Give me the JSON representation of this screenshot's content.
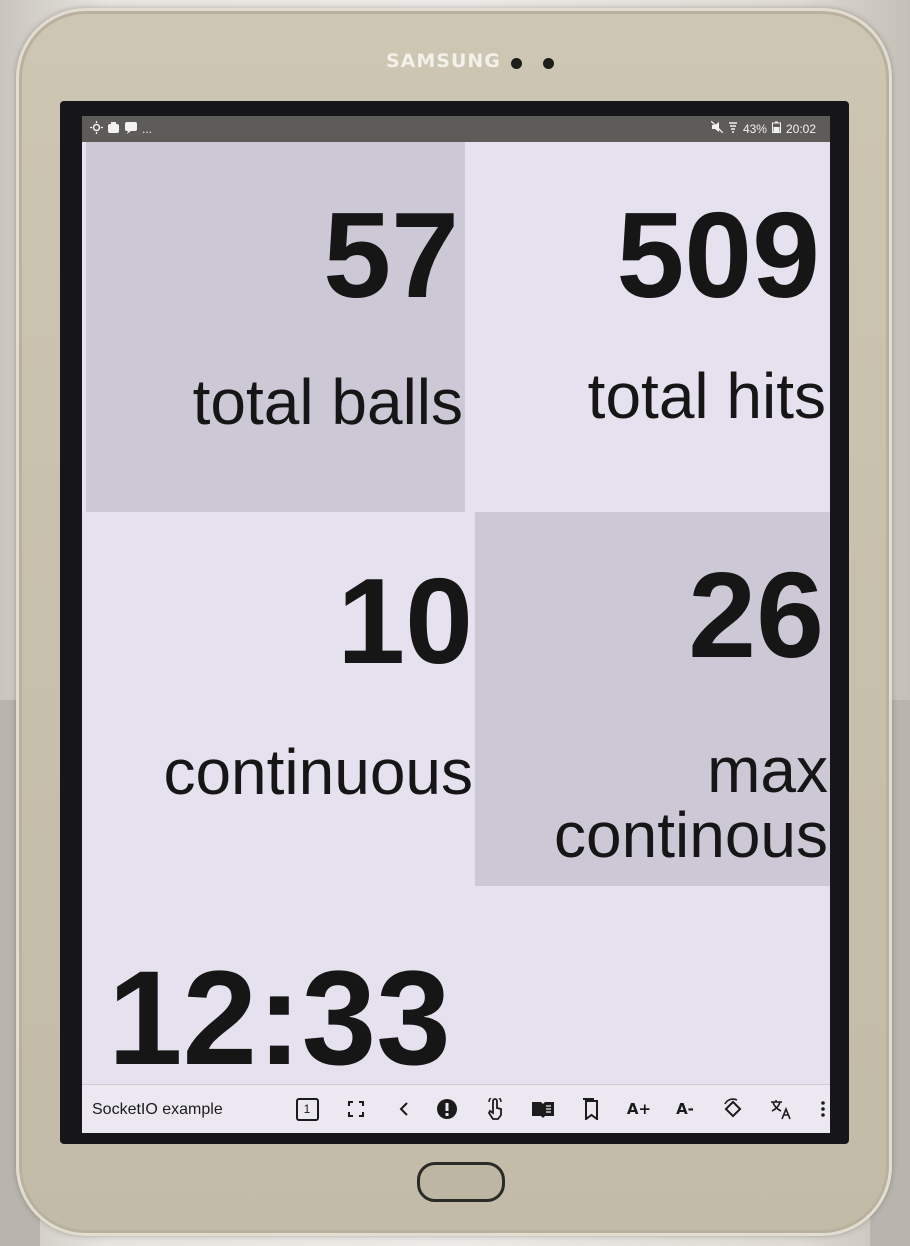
{
  "device": {
    "brand": "SAMSUNG"
  },
  "status_bar": {
    "left_icons": [
      "notification-icon",
      "app-icon",
      "chat-icon"
    ],
    "more": "...",
    "mute_icon": "mute-icon",
    "signal_icon": "signal-icon",
    "battery_percent": "43%",
    "battery_icon": "battery-icon",
    "time": "20:02"
  },
  "stats": {
    "total_balls": {
      "value": "57",
      "label": "total balls"
    },
    "total_hits": {
      "value": "509",
      "label": "total hits"
    },
    "continuous": {
      "value": "10",
      "label": "continuous"
    },
    "max_continuous": {
      "value": "26",
      "label_line1": "max",
      "label_line2": "continous"
    },
    "timer": "12:33"
  },
  "colors": {
    "tile_dark": "#cdc8d6",
    "tile_light": "#e6e1ee",
    "text": "#161616"
  },
  "toolbar": {
    "title": "SocketIO example",
    "page_number": "1",
    "icons": {
      "page": "page-number-icon",
      "fullscreen": "fullscreen-icon",
      "back": "back-icon",
      "alert": "alert-icon",
      "touch": "touch-icon",
      "reader": "reader-icon",
      "bookmark": "bookmark-icon",
      "font_up_label": "A+",
      "font_down_label": "A-",
      "rotate": "rotate-icon",
      "translate": "translate-icon",
      "more": "more-icon"
    }
  }
}
